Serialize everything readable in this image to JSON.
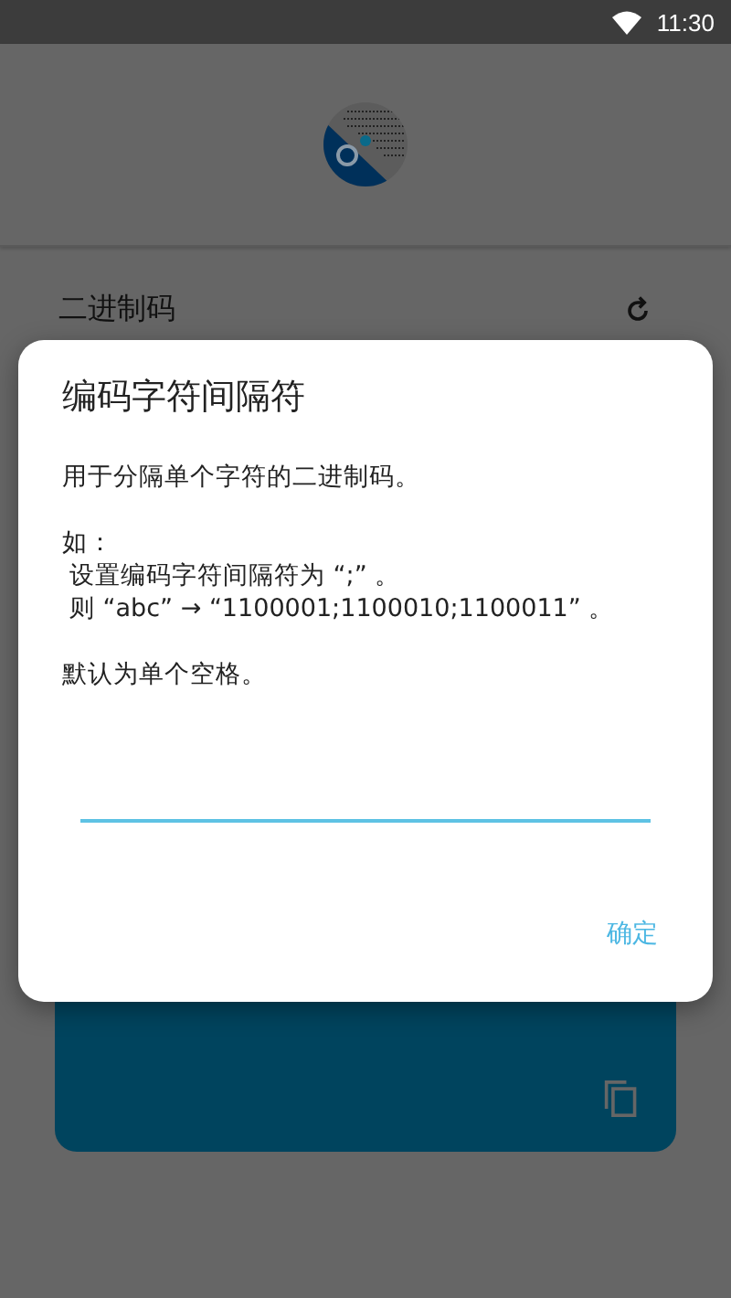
{
  "status_bar": {
    "time": "11:30"
  },
  "section": {
    "title": "二进制码"
  },
  "dialog": {
    "title": "编码字符间隔符",
    "paragraphs": [
      {
        "lines": [
          "用于分隔单个字符的二进制码。"
        ]
      },
      {
        "lines": [
          "如：",
          "设置编码字符间隔符为 “;” 。",
          "则 “abc” → “1100001;1100010;1100011” 。"
        ]
      },
      {
        "lines": [
          "默认为单个空格。"
        ]
      }
    ],
    "input": {
      "focused": true
    },
    "buttons": [
      "确定"
    ]
  }
}
